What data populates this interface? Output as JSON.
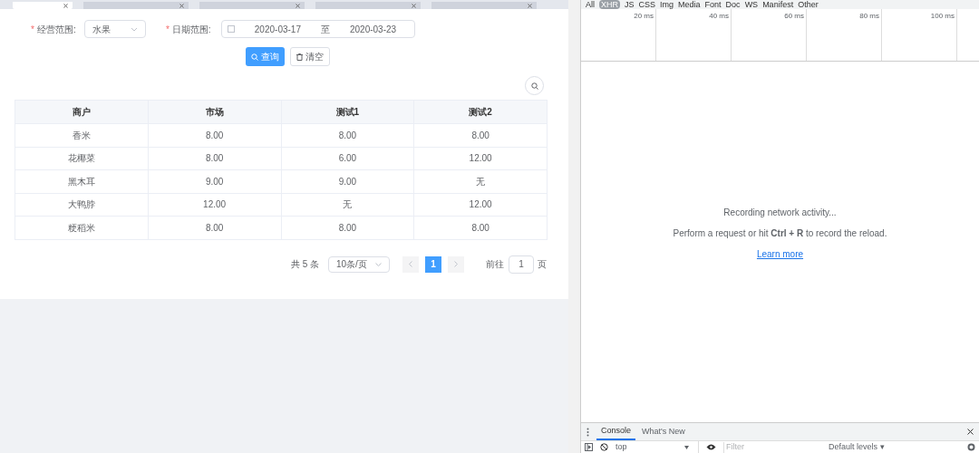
{
  "app_tabs": [
    {
      "selected": true
    },
    {
      "selected": false
    },
    {
      "selected": false
    },
    {
      "selected": false
    },
    {
      "selected": false
    }
  ],
  "form": {
    "scope_mark": "*",
    "date_mark": "*",
    "scope_label": "经营范围:",
    "scope_value": "水果",
    "date_label": "日期范围:",
    "date_start": "2020-03-17",
    "date_sep": "至",
    "date_end": "2020-03-23",
    "query_button": "查询",
    "clear_button": "清空"
  },
  "table": {
    "columns": [
      "商户",
      "市场",
      "测试1",
      "测试2"
    ],
    "rows": [
      [
        "香米",
        "8.00",
        "8.00",
        "8.00"
      ],
      [
        "花椰菜",
        "8.00",
        "6.00",
        "12.00"
      ],
      [
        "黑木耳",
        "9.00",
        "9.00",
        "无"
      ],
      [
        "大鸭脖",
        "12.00",
        "无",
        "12.00"
      ],
      [
        "粳稻米",
        "8.00",
        "8.00",
        "8.00"
      ]
    ]
  },
  "pagination": {
    "total": "共 5 条",
    "page_size": "10条/页",
    "pages": [
      {
        "label": "1",
        "selected": true
      }
    ],
    "goto_label": "前往",
    "goto_value": "1",
    "page_unit": "页"
  },
  "devtools": {
    "filters": [
      {
        "label": "All",
        "selected": false
      },
      {
        "label": "XHR",
        "selected": true
      },
      {
        "label": "JS",
        "selected": false
      },
      {
        "label": "CSS",
        "selected": false
      },
      {
        "label": "Img",
        "selected": false
      },
      {
        "label": "Media",
        "selected": false
      },
      {
        "label": "Font",
        "selected": false
      },
      {
        "label": "Doc",
        "selected": false
      },
      {
        "label": "WS",
        "selected": false
      },
      {
        "label": "Manifest",
        "selected": false
      },
      {
        "label": "Other",
        "selected": false
      }
    ],
    "ticks": [
      "20 ms",
      "40 ms",
      "60 ms",
      "80 ms",
      "100 ms"
    ],
    "empty_title": "Recording network activity...",
    "empty_hint": "Perform a request or hit **Ctrl + R** to record the reload.",
    "learn_more": "Learn more",
    "drawer_tabs": [
      {
        "label": "Console",
        "selected": true
      },
      {
        "label": "What's New",
        "selected": false
      }
    ],
    "context": "top",
    "filter_placeholder": "Filter",
    "levels": "Default levels ▾"
  }
}
